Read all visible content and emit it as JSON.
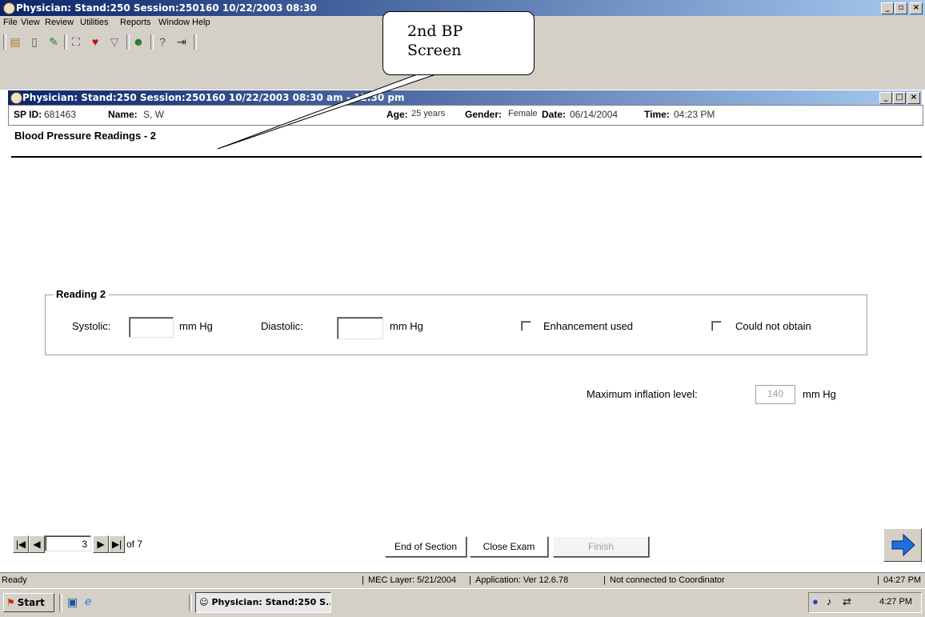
{
  "window": {
    "title": "Physician: Stand:250 Session:250160 10/22/2003 08:30",
    "minimize": "_",
    "restore": "▫",
    "close": "×"
  },
  "menu": [
    "File",
    "View",
    "Review",
    "Utilities",
    "Reports",
    "Window",
    "Help"
  ],
  "toolbar_icons": [
    "folder-icon",
    "clipboard-icon",
    "pencil-icon",
    "camera-icon",
    "heart-icon",
    "cup-icon",
    "people-icon",
    "help-icon",
    "exit-icon"
  ],
  "callout": {
    "line1": "2nd BP",
    "line2": "Screen"
  },
  "child_window": {
    "title": "Physician: Stand:250 Session:250160 10/22/2003 08:30 am - 12:30 pm",
    "minimize": "_",
    "restore": "□",
    "close": "×"
  },
  "patient": {
    "sp_id_label": "SP ID:",
    "sp_id": "681463",
    "name_label": "Name:",
    "name": "S, W",
    "age_label": "Age:",
    "age": "25 years",
    "gender_label": "Gender:",
    "gender": "Female",
    "date_label": "Date:",
    "date": "06/14/2004",
    "time_label": "Time:",
    "time": "04:23 PM"
  },
  "section_title": "Blood Pressure Readings - 2",
  "reading": {
    "group_label": "Reading 2",
    "systolic_label": "Systolic:",
    "systolic_value": "",
    "systolic_unit": "mm Hg",
    "diastolic_label": "Diastolic:",
    "diastolic_value": "",
    "diastolic_unit": "mm Hg",
    "enhancement_label": "Enhancement used",
    "enhancement_checked": false,
    "could_not_obtain_label": "Could not obtain",
    "could_not_obtain_checked": false
  },
  "inflation": {
    "label": "Maximum inflation level:",
    "value": "140",
    "unit": "mm Hg"
  },
  "navigation": {
    "first": "|◀",
    "prev": "◀",
    "page": "3",
    "next": "▶",
    "last": "▶|",
    "of_total": "of 7"
  },
  "buttons": {
    "end_of_section": "End of Section",
    "close_exam": "Close Exam",
    "finish": "Finish"
  },
  "status": {
    "ready": "Ready",
    "mec_layer": "MEC Layer: 5/21/2004",
    "application": "Application: Ver 12.6.78",
    "coordinator": "Not connected to Coordinator",
    "time": "04:27 PM"
  },
  "taskbar": {
    "start": "Start",
    "task": "Physician: Stand:250 S...",
    "clock": "4:27 PM"
  },
  "colors": {
    "title_gradient_start": "#0a246a",
    "title_gradient_end": "#a6caf0",
    "chrome": "#d4d0c8",
    "next_arrow": "#1e6fd9"
  }
}
